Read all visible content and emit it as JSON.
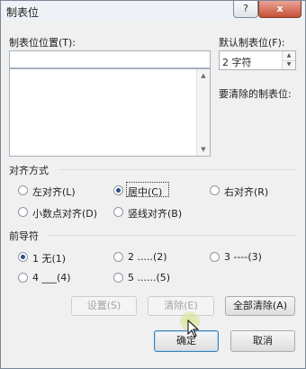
{
  "window": {
    "title": "制表位",
    "help_label": "?",
    "close_label": "x"
  },
  "tab_position": {
    "label": "制表位位置(T):",
    "value": ""
  },
  "default_tab": {
    "label": "默认制表位(F):",
    "value": "2 字符"
  },
  "tabs_to_clear_label": "要清除的制表位:",
  "alignment": {
    "title": "对齐方式",
    "options": [
      "左对齐(L)",
      "居中(C)",
      "右对齐(R)",
      "小数点对齐(D)",
      "竖线对齐(B)"
    ],
    "selected": "居中(C)"
  },
  "leader": {
    "title": "前导符",
    "options": [
      "1 无(1)",
      "2 .....(2)",
      "3 ----(3)",
      "4 ___(4)",
      "5 ......(5)"
    ],
    "selected": "1 无(1)"
  },
  "buttons": {
    "set": "设置(S)",
    "clear": "清除(E)",
    "clear_all": "全部清除(A)",
    "ok": "确定",
    "cancel": "取消"
  }
}
